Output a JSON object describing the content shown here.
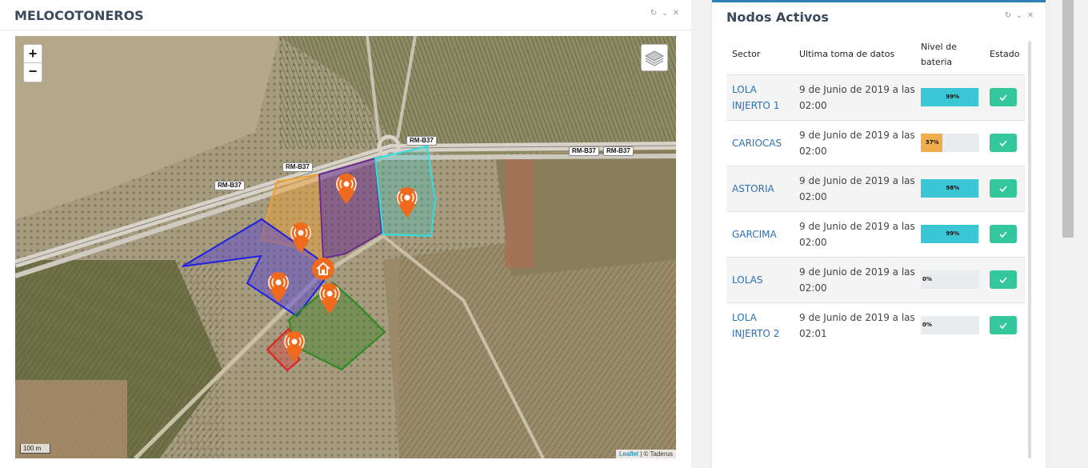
{
  "left_panel": {
    "title": "MELOCOTONEROS",
    "tools": {
      "refresh": "↻",
      "collapse": "⌄",
      "close": "✕"
    }
  },
  "map": {
    "zoom_in": "+",
    "zoom_out": "−",
    "scale": "100 m",
    "attribution_leaflet": "Leaflet",
    "attribution_rest": " | © Taderus",
    "road_labels": [
      "RM-B37",
      "RM-B37",
      "RM-B37",
      "RM-B37",
      "RM-B37"
    ],
    "icons": {
      "layers": "layers-icon",
      "sensor": "sensor-marker-icon",
      "home": "home-marker-icon"
    },
    "colors": {
      "marker": "#f06a1e",
      "plot_orange": "#f0a030",
      "plot_purple": "#6a2c8c",
      "plot_cyan": "#30e0e0",
      "plot_blue": "#2020e0",
      "plot_green": "#2a8a1e",
      "plot_red": "#e02020"
    }
  },
  "right_panel": {
    "title": "Nodos Activos",
    "tools": {
      "refresh": "↻",
      "collapse": "⌄",
      "close": "✕"
    },
    "headers": {
      "sector": "Sector",
      "date": "Ultima toma de datos",
      "battery": "Nivel de bateria",
      "state": "Estado"
    },
    "rows": [
      {
        "sector": "LOLA INJERTO 1",
        "date": "9 de Junio de 2019 a las 02:00",
        "battery": 99,
        "battery_label": "99%",
        "bar_color": "#3bc6d6"
      },
      {
        "sector": "CARIOCAS",
        "date": "9 de Junio de 2019 a las 02:00",
        "battery": 37,
        "battery_label": "37%",
        "bar_color": "#f0ad4e"
      },
      {
        "sector": "ASTORIA",
        "date": "9 de Junio de 2019 a las 02:00",
        "battery": 98,
        "battery_label": "98%",
        "bar_color": "#3bc6d6"
      },
      {
        "sector": "GARCIMA",
        "date": "9 de Junio de 2019 a las 02:00",
        "battery": 99,
        "battery_label": "99%",
        "bar_color": "#3bc6d6"
      },
      {
        "sector": "LOLAS",
        "date": "9 de Junio de 2019 a las 02:00",
        "battery": 0,
        "battery_label": "0%",
        "bar_color": "#3bc6d6"
      },
      {
        "sector": "LOLA INJERTO 2",
        "date": "9 de Junio de 2019 a las 02:01",
        "battery": 0,
        "battery_label": "0%",
        "bar_color": "#3bc6d6"
      }
    ],
    "state_icon": "check-icon",
    "state_color": "#34c79c"
  }
}
